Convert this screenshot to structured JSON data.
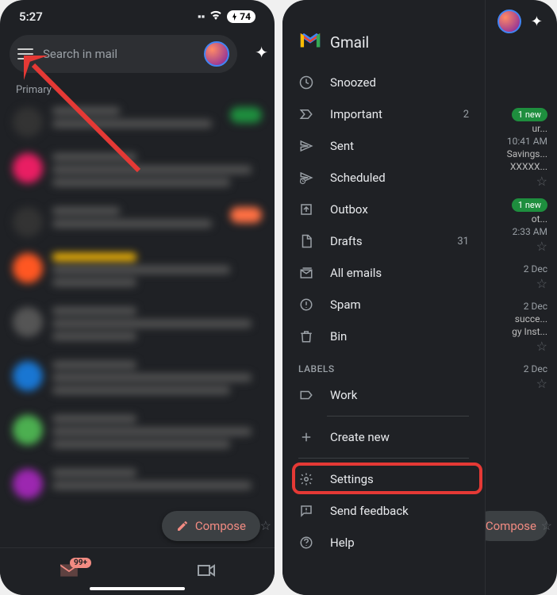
{
  "left": {
    "status_time": "5:27",
    "battery": "74",
    "search_placeholder": "Search in mail",
    "category": "Primary",
    "compose": "Compose",
    "unread_badge": "99+"
  },
  "right": {
    "app_name": "Gmail",
    "drawer": {
      "items": [
        {
          "icon": "clock",
          "label": "Snoozed",
          "count": ""
        },
        {
          "icon": "important",
          "label": "Important",
          "count": "2"
        },
        {
          "icon": "send",
          "label": "Sent",
          "count": ""
        },
        {
          "icon": "scheduled",
          "label": "Scheduled",
          "count": ""
        },
        {
          "icon": "outbox",
          "label": "Outbox",
          "count": ""
        },
        {
          "icon": "draft",
          "label": "Drafts",
          "count": "31"
        },
        {
          "icon": "allmail",
          "label": "All emails",
          "count": ""
        },
        {
          "icon": "spam",
          "label": "Spam",
          "count": ""
        },
        {
          "icon": "bin",
          "label": "Bin",
          "count": ""
        }
      ],
      "labels_header": "LABELS",
      "label_items": [
        {
          "icon": "label",
          "label": "Work"
        }
      ],
      "create_new": "Create new",
      "footer": [
        {
          "icon": "settings",
          "label": "Settings"
        },
        {
          "icon": "feedback",
          "label": "Send feedback"
        },
        {
          "icon": "help",
          "label": "Help"
        }
      ]
    },
    "bg_emails": [
      {
        "badge": "1 new",
        "line1": "ur...",
        "time": "10:41 AM",
        "line2": "Savings...",
        "line3": "XXXXX..."
      },
      {
        "badge": "1 new",
        "line1": "ot...",
        "time": "2:33 AM"
      },
      {
        "time": "2 Dec"
      },
      {
        "time": "2 Dec",
        "line2": "succe...",
        "line3": "gy Inst..."
      },
      {
        "time": "2 Dec"
      }
    ],
    "compose": "Compose"
  }
}
